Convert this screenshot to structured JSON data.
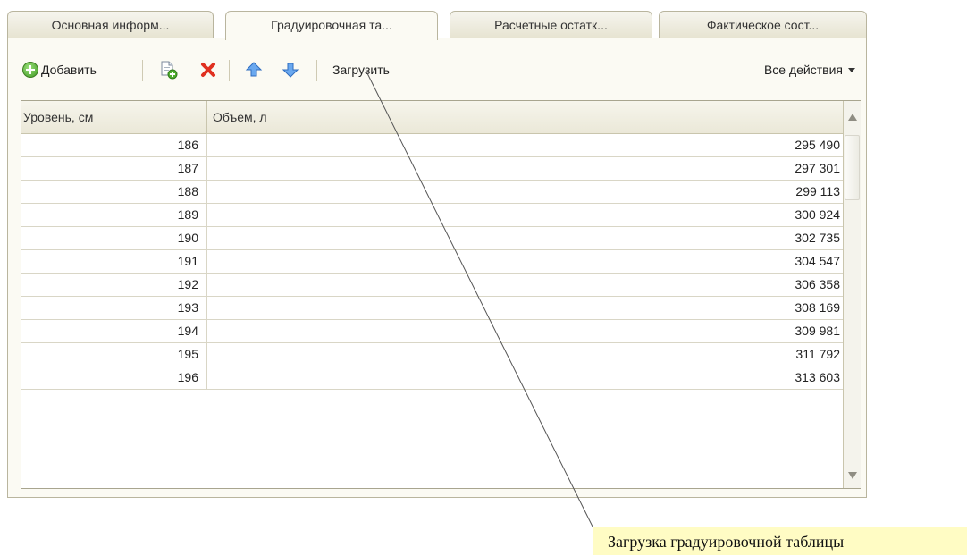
{
  "tabs": [
    {
      "label": "Основная информ...",
      "active": false
    },
    {
      "label": "Градуировочная та...",
      "active": true
    },
    {
      "label": "Расчетные остатк...",
      "active": false
    },
    {
      "label": "Фактическое сост...",
      "active": false
    }
  ],
  "toolbar": {
    "add_label": "Добавить",
    "load_label": "Загрузить",
    "all_actions_label": "Все действия",
    "icons": [
      "copy-icon",
      "delete-icon",
      "move-up-icon",
      "move-down-icon"
    ]
  },
  "table": {
    "columns": [
      "Уровень, см",
      "Объем, л"
    ],
    "rows": [
      {
        "level": "186",
        "volume": "295 490"
      },
      {
        "level": "187",
        "volume": "297 301"
      },
      {
        "level": "188",
        "volume": "299 113"
      },
      {
        "level": "189",
        "volume": "300 924"
      },
      {
        "level": "190",
        "volume": "302 735"
      },
      {
        "level": "191",
        "volume": "304 547"
      },
      {
        "level": "192",
        "volume": "306 358"
      },
      {
        "level": "193",
        "volume": "308 169"
      },
      {
        "level": "194",
        "volume": "309 981"
      },
      {
        "level": "195",
        "volume": "311 792"
      },
      {
        "level": "196",
        "volume": "313 603"
      }
    ]
  },
  "callout": {
    "text": "Загрузка градуировочной таблицы"
  },
  "colors": {
    "panel_bg": "#fbfaf3",
    "border": "#b9b59e",
    "callout_bg": "#fffcc4",
    "delete": "#e03020",
    "arrow": "#4a8fe0"
  }
}
